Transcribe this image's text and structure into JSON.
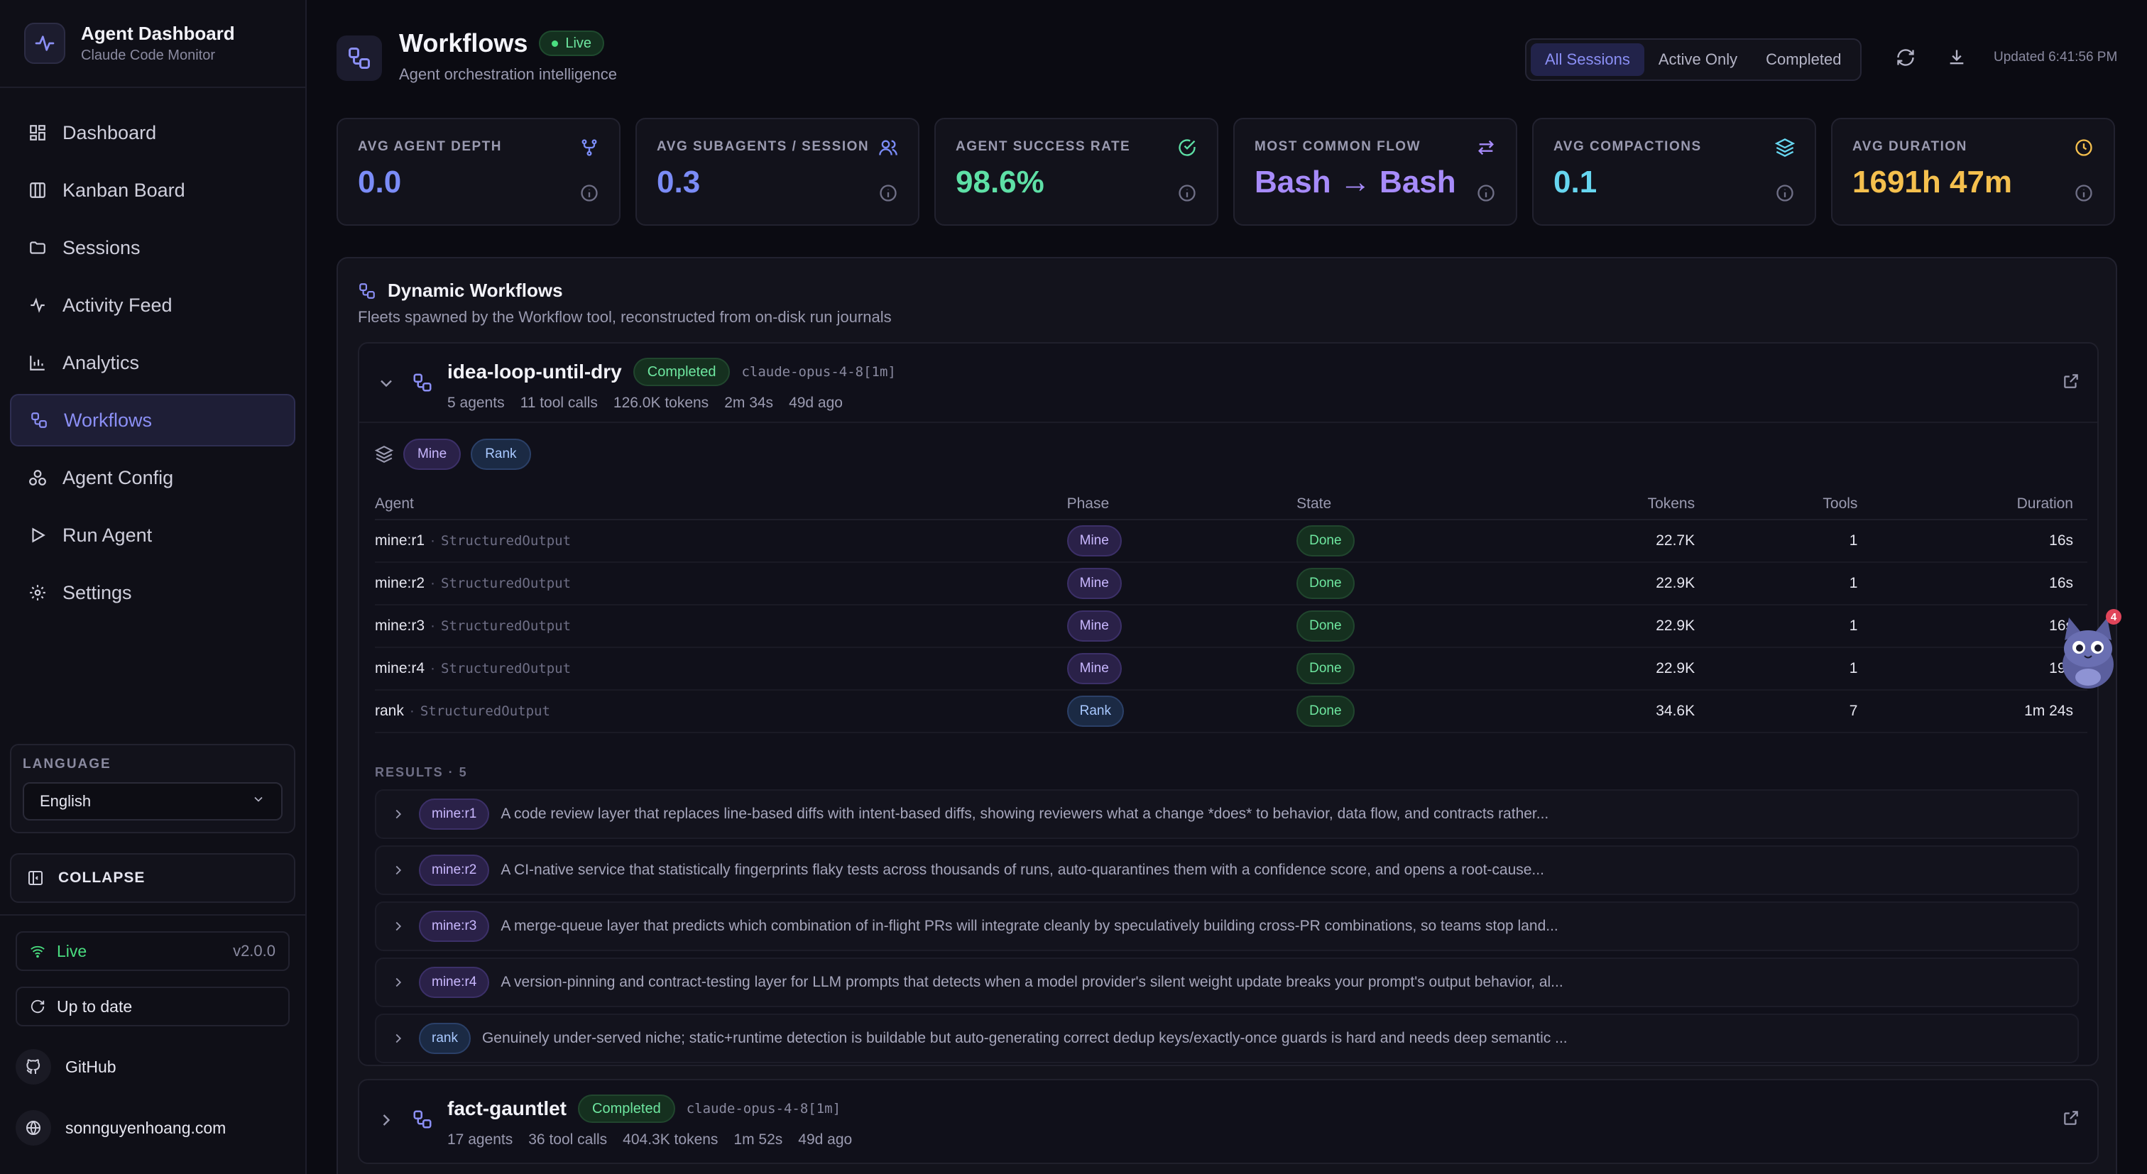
{
  "app": {
    "title": "Agent Dashboard",
    "subtitle": "Claude Code Monitor"
  },
  "sidebar": {
    "items": [
      {
        "label": "Dashboard",
        "icon": "dashboard-icon"
      },
      {
        "label": "Kanban Board",
        "icon": "kanban-icon"
      },
      {
        "label": "Sessions",
        "icon": "folder-icon"
      },
      {
        "label": "Activity Feed",
        "icon": "activity-icon"
      },
      {
        "label": "Analytics",
        "icon": "bar-chart-icon"
      },
      {
        "label": "Workflows",
        "icon": "workflow-icon",
        "active": true
      },
      {
        "label": "Agent Config",
        "icon": "agent-config-icon"
      },
      {
        "label": "Run Agent",
        "icon": "play-icon"
      },
      {
        "label": "Settings",
        "icon": "gear-icon"
      }
    ],
    "language_label": "LANGUAGE",
    "language_value": "English",
    "collapse_label": "COLLAPSE",
    "status_label": "Live",
    "version": "v2.0.0",
    "update_label": "Up to date",
    "github_label": "GitHub",
    "website_label": "sonnguyenhoang.com"
  },
  "header": {
    "title": "Workflows",
    "badge": "Live",
    "subtitle": "Agent orchestration intelligence",
    "filters": [
      "All Sessions",
      "Active Only",
      "Completed"
    ],
    "active_filter": "All Sessions",
    "updated": "Updated 6:41:56 PM"
  },
  "stats": [
    {
      "label": "AVG AGENT DEPTH",
      "value": "0.0",
      "color": "#7b8cf7",
      "icon": "git-fork-icon"
    },
    {
      "label": "AVG SUBAGENTS / SESSION",
      "value": "0.3",
      "color": "#7b8cf7",
      "icon": "users-icon"
    },
    {
      "label": "AGENT SUCCESS RATE",
      "value": "98.6%",
      "color": "#5ee0a6",
      "icon": "check-circle-icon"
    },
    {
      "label": "MOST COMMON FLOW",
      "value": "Bash → Bash",
      "color": "#a78bfa",
      "icon": "arrows-swap-icon"
    },
    {
      "label": "AVG COMPACTIONS",
      "value": "0.1",
      "color": "#67d6f0",
      "icon": "layers-icon"
    },
    {
      "label": "AVG DURATION",
      "value": "1691h 47m",
      "color": "#f5c04e",
      "icon": "clock-icon"
    }
  ],
  "panel": {
    "title": "Dynamic Workflows",
    "subtitle": "Fleets spawned by the Workflow tool, reconstructed from on-disk run journals"
  },
  "workflows": [
    {
      "name": "idea-loop-until-dry",
      "status": "Completed",
      "model": "claude-opus-4-8[1m]",
      "agents": "5 agents",
      "tool_calls": "11 tool calls",
      "tokens": "126.0K tokens",
      "duration": "2m 34s",
      "age": "49d ago",
      "phases": [
        "Mine",
        "Rank"
      ],
      "columns": [
        "Agent",
        "Phase",
        "State",
        "Tokens",
        "Tools",
        "Duration"
      ],
      "rows": [
        {
          "agent": "mine:r1",
          "tool": "StructuredOutput",
          "phase": "Mine",
          "state": "Done",
          "tokens": "22.7K",
          "tools": "1",
          "duration": "16s"
        },
        {
          "agent": "mine:r2",
          "tool": "StructuredOutput",
          "phase": "Mine",
          "state": "Done",
          "tokens": "22.9K",
          "tools": "1",
          "duration": "16s"
        },
        {
          "agent": "mine:r3",
          "tool": "StructuredOutput",
          "phase": "Mine",
          "state": "Done",
          "tokens": "22.9K",
          "tools": "1",
          "duration": "16s"
        },
        {
          "agent": "mine:r4",
          "tool": "StructuredOutput",
          "phase": "Mine",
          "state": "Done",
          "tokens": "22.9K",
          "tools": "1",
          "duration": "19s"
        },
        {
          "agent": "rank",
          "tool": "StructuredOutput",
          "phase": "Rank",
          "state": "Done",
          "tokens": "34.6K",
          "tools": "7",
          "duration": "1m 24s"
        }
      ],
      "results_label": "RESULTS · 5",
      "results": [
        {
          "agent": "mine:r1",
          "text": "A code review layer that replaces line-based diffs with intent-based diffs, showing reviewers what a change *does* to behavior, data flow, and contracts rather..."
        },
        {
          "agent": "mine:r2",
          "text": "A CI-native service that statistically fingerprints flaky tests across thousands of runs, auto-quarantines them with a confidence score, and opens a root-cause..."
        },
        {
          "agent": "mine:r3",
          "text": "A merge-queue layer that predicts which combination of in-flight PRs will integrate cleanly by speculatively building cross-PR combinations, so teams stop land..."
        },
        {
          "agent": "mine:r4",
          "text": "A version-pinning and contract-testing layer for LLM prompts that detects when a model provider's silent weight update breaks your prompt's output behavior, al..."
        },
        {
          "agent": "rank",
          "text": "Genuinely under-served niche; static+runtime detection is buildable but auto-generating correct dedup keys/exactly-once guards is hard and needs deep semantic ..."
        }
      ]
    },
    {
      "name": "fact-gauntlet",
      "status": "Completed",
      "model": "claude-opus-4-8[1m]",
      "agents": "17 agents",
      "tool_calls": "36 tool calls",
      "tokens": "404.3K tokens",
      "duration": "1m 52s",
      "age": "49d ago"
    }
  ],
  "mascot": {
    "badge": "4"
  }
}
